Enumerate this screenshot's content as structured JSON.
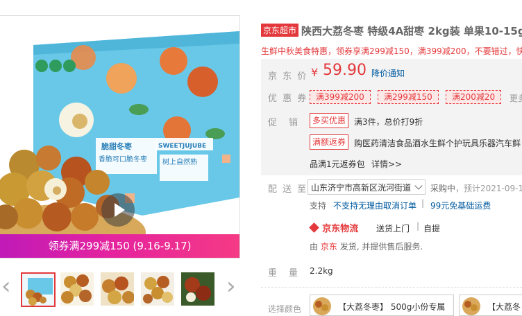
{
  "product": {
    "title": "陕西大荔冬枣 特级4A甜枣 2kg装 单果10-15g",
    "badge": "京东超市",
    "subtitle": "生鲜中秋美食特惠，领券享满299减150，满399减200，不要错过，快来",
    "box_labels": [
      "脆甜冬枣",
      "SWEETJUJUBE",
      "香脆可口脆冬枣",
      "树上自然熟"
    ]
  },
  "gallery": {
    "coupon_banner": "领券满299减150 (9.16-9.17)",
    "prev_arrow": "‹",
    "next_arrow": "›"
  },
  "price": {
    "label": "京 东 价",
    "symbol": "¥",
    "value": "59.90",
    "notice_link": "降价通知"
  },
  "coupons": {
    "label": "优 惠 券",
    "items": [
      "满399减200",
      "满299减150",
      "满200减20"
    ],
    "more": "更多"
  },
  "promotions": {
    "label": "促　销",
    "tag1": "多买优惠",
    "desc1": "满3件，总价打9折",
    "tag2": "满额返券",
    "desc2": "购医药清洁食品酒水生鲜个护玩具乐器汽车鲜",
    "desc2b": "品满1元返券包",
    "detail": "详情>>"
  },
  "delivery": {
    "label": "配 送 至",
    "address": "山东济宁市高新区洸河街道",
    "status": "采购中",
    "eta": "，预计2021-09-1",
    "support_label": "支持",
    "support_1": "不支持无理由取消订单",
    "support_2": "99元免基础运费",
    "logistics_brand": "京东物流",
    "logistics_1": "送货上门",
    "logistics_2": "自提",
    "fulfil_1": "由",
    "fulfil_jd": "京东",
    "fulfil_2": "发货, 并提供售后服务."
  },
  "weight": {
    "label": "重　量",
    "value": "2.2kg"
  },
  "color_select": {
    "label": "选择颜色",
    "options": [
      "【大荔冬枣】 500g小份专属",
      "【大荔冬"
    ]
  },
  "colors": {
    "accent": "#e4393c",
    "link": "#005aa0",
    "banner": "#d8219f",
    "box_blue": "#57c3e6"
  }
}
